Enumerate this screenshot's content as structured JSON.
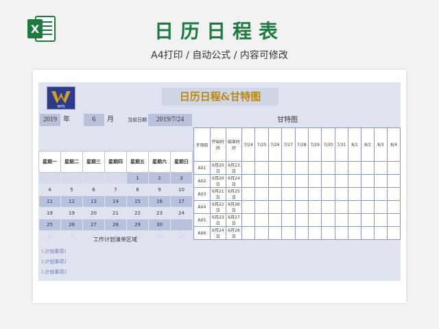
{
  "page": {
    "title": "日历日程表",
    "subtitle": "A4打印 / 自动公式 / 内容可修改"
  },
  "brand": {
    "accent": "#1d7a3e",
    "panel": "#dfe3f0",
    "cell": "#b9c1dc",
    "banner_text": "#b8860b"
  },
  "sheet": {
    "banner": "日历日程&甘特图",
    "logo_text": "WPS",
    "controls": {
      "year": "2019",
      "year_unit": "年",
      "month": "6",
      "month_unit": "月",
      "today_label": "当前日期",
      "today_value": "2019/7/24"
    },
    "calendar": {
      "headers": [
        "星期一",
        "星期二",
        "星期三",
        "星期四",
        "星期五",
        "星期六",
        "星期日"
      ],
      "rows": [
        [
          "",
          "",
          "",
          "",
          "1",
          "2",
          "3"
        ],
        [
          "4",
          "5",
          "6",
          "7",
          "8",
          "9",
          "10"
        ],
        [
          "11",
          "12",
          "13",
          "14",
          "15",
          "16",
          "17"
        ],
        [
          "18",
          "19",
          "20",
          "21",
          "22",
          "23",
          "24"
        ],
        [
          "25",
          "26",
          "27",
          "28",
          "29",
          "30",
          ""
        ],
        [
          "6",
          "7",
          "8",
          "9",
          "10",
          "11",
          "12"
        ]
      ]
    },
    "gantt": {
      "title": "甘特图",
      "columns": [
        "子项目",
        "开始时间",
        "结束时间",
        "7/24",
        "7/25",
        "7/26",
        "7/27",
        "7/28",
        "7/29",
        "7/30",
        "7/31",
        "8/1",
        "8/2",
        "8/3",
        "8/4"
      ],
      "rows": [
        [
          "AX1",
          "6月20日",
          "6月23日"
        ],
        [
          "AX2",
          "6月20日",
          "6月24日"
        ],
        [
          "AX3",
          "6月21日",
          "6月25日"
        ],
        [
          "AX4",
          "6月22日",
          "6月26日"
        ],
        [
          "AX5",
          "6月23日",
          "6月27日"
        ],
        [
          "AX6",
          "6月24日",
          "6月28日"
        ]
      ]
    },
    "plan": {
      "title": "工作计划清单区域",
      "items": [
        "1.计划事项1",
        "1.计划事项2",
        "1.计划事项3"
      ]
    }
  }
}
